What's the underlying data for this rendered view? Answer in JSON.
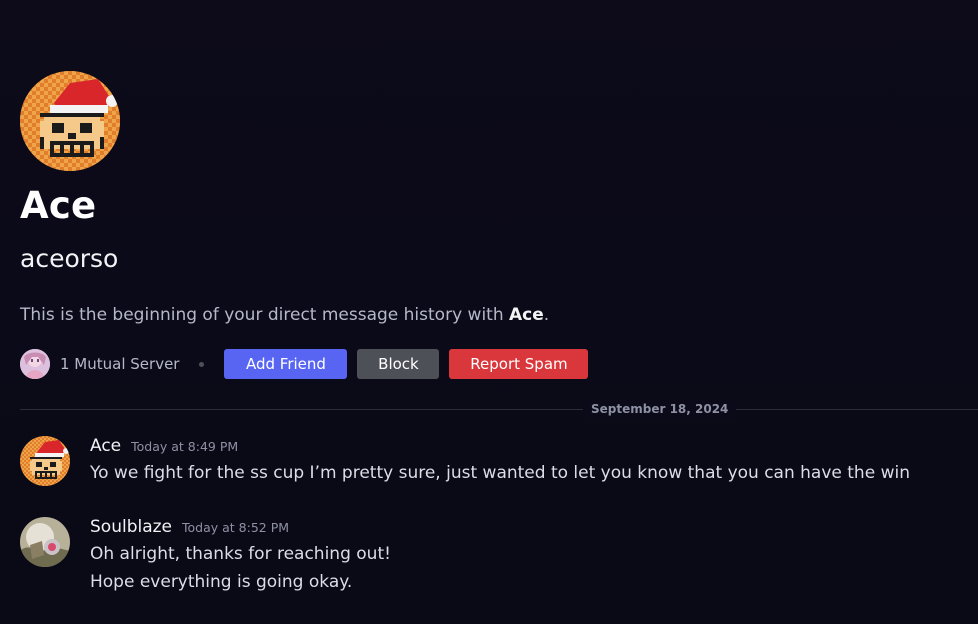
{
  "profile": {
    "display_name": "Ace",
    "username": "aceorso",
    "intro_prefix": "This is the beginning of your direct message history with ",
    "intro_name": "Ace",
    "intro_suffix": "."
  },
  "mutual": {
    "label": "1 Mutual Server"
  },
  "actions": {
    "add_friend": "Add Friend",
    "block": "Block",
    "report_spam": "Report Spam"
  },
  "date_divider": "September 18, 2024",
  "messages": [
    {
      "author": "Ace",
      "timestamp": "Today at 8:49 PM",
      "lines": [
        "Yo we fight for the ss cup I’m pretty sure, just wanted to let you know that you can have the win"
      ]
    },
    {
      "author": "Soulblaze",
      "timestamp": "Today at 8:52 PM",
      "lines": [
        "Oh alright, thanks for reaching out!",
        "Hope everything is going okay."
      ]
    }
  ],
  "colors": {
    "background": "#0b0a18",
    "blurple": "#5865f2",
    "grey_button": "#4e5058",
    "danger": "#da373c"
  },
  "icons": {
    "hero_avatar": "pixel-skull-santa-hat-avatar",
    "server": "server-icon",
    "soulblaze_avatar": "user-avatar"
  }
}
